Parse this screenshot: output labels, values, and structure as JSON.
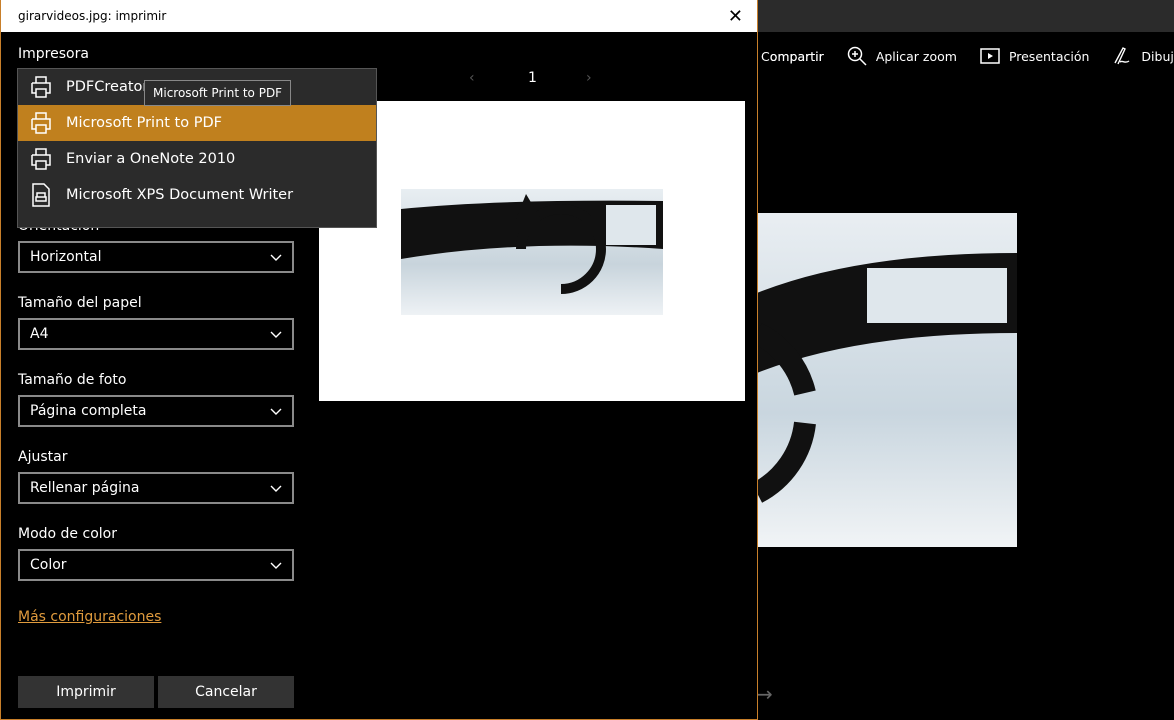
{
  "dialog_title": "girarvideos.jpg: imprimir",
  "toolbar": [
    {
      "label": "Compartir",
      "icon": "share-icon"
    },
    {
      "label": "Aplicar zoom",
      "icon": "zoom-in-icon"
    },
    {
      "label": "Presentación",
      "icon": "slideshow-icon"
    },
    {
      "label": "Dibujar",
      "icon": "draw-icon"
    }
  ],
  "toolbar_partial": "ompartir",
  "printer_label": "Impresora",
  "printers": [
    "PDFCreator",
    "Microsoft Print to PDF",
    "Enviar a OneNote 2010",
    "Microsoft XPS Document Writer"
  ],
  "selected_printer": "Microsoft Print to PDF",
  "tooltip": "Microsoft Print to PDF",
  "settings": [
    {
      "label": "Orientación",
      "value": "Horizontal"
    },
    {
      "label": "Tamaño del papel",
      "value": "A4"
    },
    {
      "label": "Tamaño de foto",
      "value": "Página completa"
    },
    {
      "label": "Ajustar",
      "value": "Rellenar página"
    },
    {
      "label": "Modo de color",
      "value": "Color"
    }
  ],
  "more_settings": "Más configuraciones",
  "print_button": "Imprimir",
  "cancel_button": "Cancelar",
  "page_number": "1",
  "accent": "#c0801e"
}
